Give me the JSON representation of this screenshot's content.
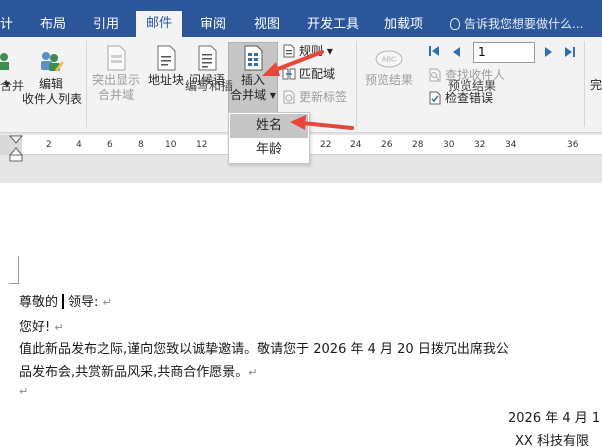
{
  "tabs": [
    "计",
    "布局",
    "引用",
    "邮件",
    "审阅",
    "视图",
    "开发工具",
    "加载项"
  ],
  "tell_me": "告诉我您想要做什么...",
  "ribbon": {
    "btn_edit_recipients": [
      "编辑",
      "收件人列表"
    ],
    "btn_highlight_fields": [
      "突出显示",
      "合并域"
    ],
    "btn_address_block": "地址块",
    "btn_greeting": "问候语",
    "btn_insert_merge_field": [
      "插入",
      "合并域"
    ],
    "btn_rules": "规则",
    "btn_match_fields": "匹配域",
    "btn_update_labels": "更新标签",
    "btn_preview_results": "预览结果",
    "btn_find_recipient": "查找收件人",
    "btn_check_errors": "检查错误",
    "record_number": "1",
    "btn_finish": "完",
    "group_start_merge": "合并",
    "group_write_insert": "编写和插",
    "group_preview": "预览结果"
  },
  "ruler_numbers": [
    "2",
    "4",
    "6",
    "8",
    "10",
    "12",
    "22",
    "24",
    "26",
    "28",
    "30",
    "32",
    "34",
    "36"
  ],
  "dropdown": {
    "items": [
      "姓名",
      "年龄"
    ]
  },
  "document": {
    "greeting_a": "尊敬的",
    "greeting_b": "领导:",
    "hello": "您好!",
    "body_1": "值此新品发布之际,谨向您致以诚挚邀请。敬请您于 2026 年 4 月 20 日拨冗出席我公",
    "body_2": "品发布会,共赏新品风采,共商合作愿景。",
    "date": "2026 年 4 月 1",
    "company": "XX 科技有限"
  },
  "colors": {
    "brand_blue": "#2b579a",
    "ribbon_bg": "#f3f3f3",
    "arrow_red": "#e8453c"
  }
}
